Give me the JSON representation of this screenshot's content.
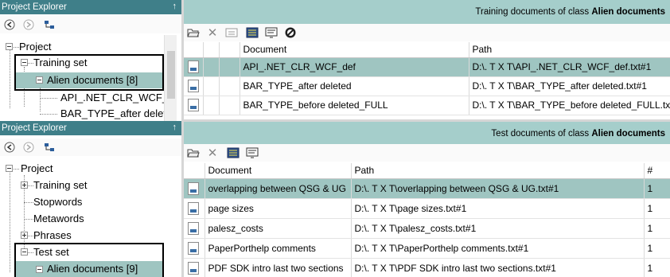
{
  "top_explorer": {
    "title": "Project Explorer",
    "pin": "↑",
    "tree": [
      {
        "label": "Project"
      },
      {
        "label": "Training set"
      },
      {
        "label": "Alien documents [8]"
      },
      {
        "label": "API_.NET_CLR_WCF_"
      },
      {
        "label": "BAR_TYPE_after delet"
      }
    ]
  },
  "bottom_explorer": {
    "title": "Project Explorer",
    "pin": "↑",
    "tree": [
      {
        "label": "Project"
      },
      {
        "label": "Training set"
      },
      {
        "label": "Stopwords"
      },
      {
        "label": "Metawords"
      },
      {
        "label": "Phrases"
      },
      {
        "label": "Test set"
      },
      {
        "label": "Alien documents [9]"
      }
    ]
  },
  "training_panel": {
    "banner_prefix": "Training documents of class ",
    "banner_class": "Alien documents",
    "columns": [
      "Document",
      "Path"
    ],
    "rows": [
      {
        "document": "API_.NET_CLR_WCF_def",
        "path": "D:\\. T X T\\API_.NET_CLR_WCF_def.txt#1"
      },
      {
        "document": "BAR_TYPE_after deleted",
        "path": "D:\\. T X T\\BAR_TYPE_after deleted.txt#1"
      },
      {
        "document": "BAR_TYPE_before deleted_FULL",
        "path": "D:\\. T X T\\BAR_TYPE_before deleted_FULL.txt#1"
      }
    ]
  },
  "test_panel": {
    "banner_prefix": "Test documents of class ",
    "banner_class": "Alien documents",
    "columns": [
      "Document",
      "Path",
      "#"
    ],
    "rows": [
      {
        "document": "overlapping between QSG & UG",
        "path": "D:\\. T X T\\overlapping between QSG & UG.txt#1",
        "count": "1"
      },
      {
        "document": "page sizes",
        "path": "D:\\. T X T\\page sizes.txt#1",
        "count": "1"
      },
      {
        "document": "palesz_costs",
        "path": "D:\\. T X T\\palesz_costs.txt#1",
        "count": "1"
      },
      {
        "document": "PaperPorthelp comments",
        "path": "D:\\. T X T\\PaperPorthelp comments.txt#1",
        "count": "1"
      },
      {
        "document": "PDF SDK intro last two sections",
        "path": "D:\\. T X T\\PDF SDK intro last two sections.txt#1",
        "count": "1"
      }
    ]
  },
  "colors": {
    "titlebar": "#3f7f89",
    "banner": "#a5cecb",
    "selection": "#9fc5c1"
  }
}
